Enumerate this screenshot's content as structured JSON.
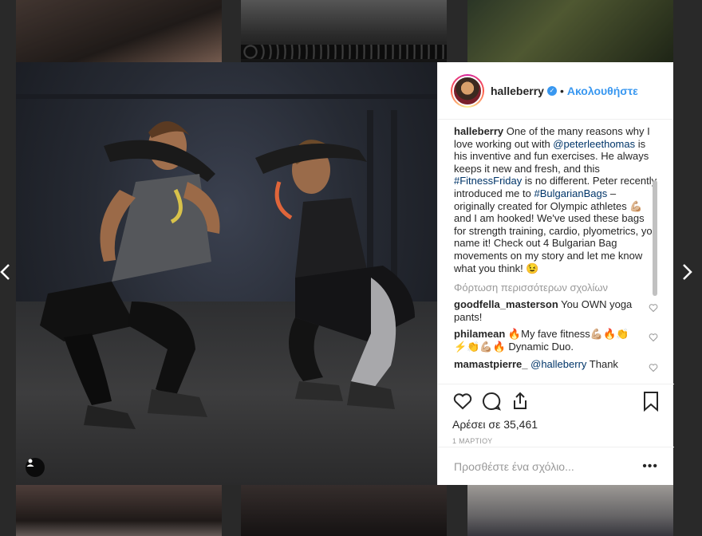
{
  "navigation": {
    "prev_icon": "chevron-left-icon",
    "next_icon": "chevron-right-icon"
  },
  "post": {
    "author": {
      "username": "halleberry",
      "verified": true,
      "separator": "•",
      "follow_label": "Ακολουθήστε"
    },
    "caption": {
      "username": "halleberry",
      "parts": {
        "p1": "One of the many reasons why I love working out with",
        "mention1": "@peterleethomas",
        "p2": "is his inventive and fun exercises. He always keeps it new and fresh, and this",
        "hashtag1": "#FitnessFriday",
        "p3": "is no different. Peter recently introduced me to",
        "hashtag2": "#BulgarianBags",
        "p4": "– originally created for Olympic athletes 💪🏼 and I am hooked! We've used these bags for strength training, cardio, plyometrics, you name it! Check out 4 Bulgarian Bag movements on my story and let me know what you think! 😉"
      }
    },
    "load_more_label": "Φόρτωση περισσότερων σχολίων",
    "comments": [
      {
        "username": "goodfella_masterson",
        "text": "You OWN yoga pants!"
      },
      {
        "username": "philamean",
        "text": "🔥My fave fitness💪🏼🔥👏⚡👏💪🏼🔥 Dynamic Duo."
      },
      {
        "username": "mamastpierre_",
        "mention": "@halleberry",
        "text": "Thank"
      }
    ],
    "likes_label": "Αρέσει σε 35,461",
    "date": "1 ΜΑΡΤΙΟΥ",
    "add_comment_placeholder": "Προσθέστε ένα σχόλιο...",
    "more_options": "•••"
  },
  "colors": {
    "accent": "#3897f0",
    "link": "#003569",
    "muted": "#999999",
    "text": "#262626"
  }
}
